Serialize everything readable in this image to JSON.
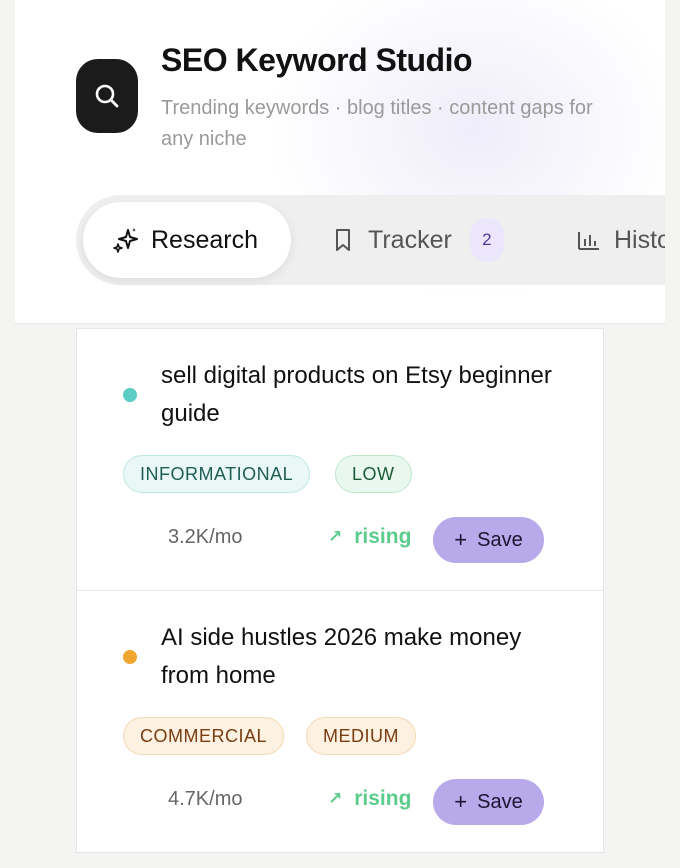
{
  "app": {
    "title": "SEO Keyword Studio",
    "subtitle": "Trending keywords · blog titles · content gaps for any niche",
    "logo_icon": "search-icon"
  },
  "tabs": [
    {
      "label": "Research",
      "icon": "sparkles-icon",
      "active": true
    },
    {
      "label": "Tracker",
      "icon": "bookmark-icon",
      "badge": "2",
      "active": false
    },
    {
      "label": "Histo",
      "icon": "bar-chart-icon",
      "active": false
    }
  ],
  "keywords": [
    {
      "title": "sell digital products on Etsy beginner guide",
      "dot_color": "#5ccdc5",
      "intent": "INFORMATIONAL",
      "difficulty": "LOW",
      "volume": "3.2K/mo",
      "trend": "rising",
      "save_label": "Save"
    },
    {
      "title": "AI side hustles 2026 make money from home",
      "dot_color": "#f0a731",
      "intent": "COMMERCIAL",
      "difficulty": "MEDIUM",
      "volume": "4.7K/mo",
      "trend": "rising",
      "save_label": "Save"
    }
  ],
  "colors": {
    "accent": "#b7a9ea",
    "trend_rising": "#5ccc8c",
    "informational_bg": "#e9f8f6",
    "low_bg": "#e8f8ee",
    "commercial_bg": "#fdf1e2",
    "medium_bg": "#fdf1e2"
  }
}
